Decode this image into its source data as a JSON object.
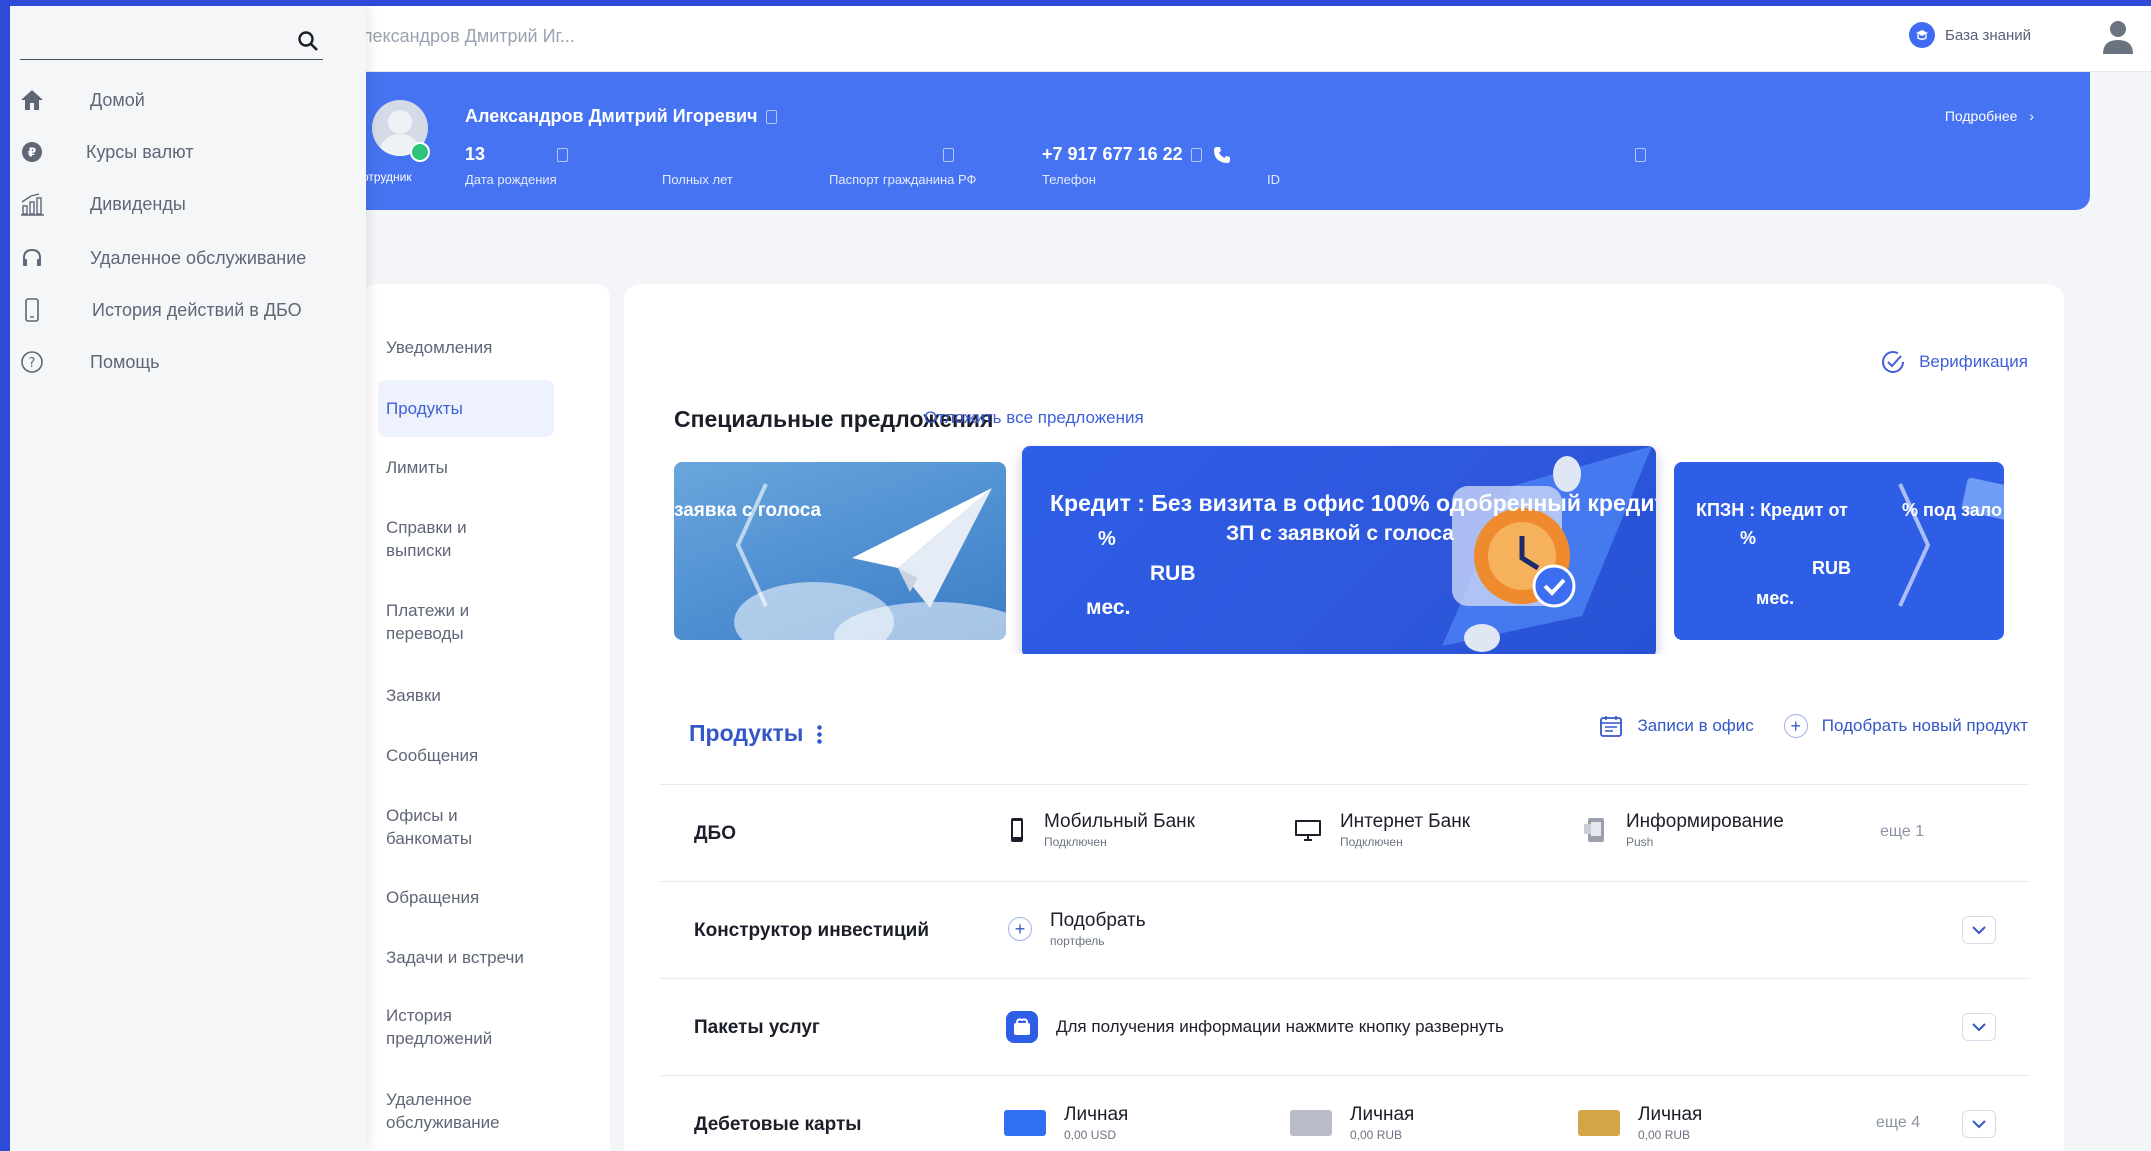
{
  "topbar": {
    "search_value": "лександров Дмитрий Иг...",
    "kb_label": "База знаний"
  },
  "client": {
    "name": "Александров Дмитрий Игоревич",
    "role": "отрудник",
    "birth_value": "13",
    "birth_label": "Дата рождения",
    "age_label": "Полных лет",
    "passport_label": "Паспорт гражданина РФ",
    "phone_value": "+7 917 677 16 22",
    "phone_label": "Телефон",
    "id_label": "ID",
    "more": "Подробнее"
  },
  "nav": {
    "items": [
      "Уведомления",
      "Продукты",
      "Лимиты",
      "Справки и выписки",
      "Платежи и переводы",
      "Заявки",
      "Сообщения",
      "Офисы и банкоматы",
      "Обращения",
      "Задачи и встречи",
      "История предложений",
      "Удаленное обслуживание"
    ],
    "active": "Продукты"
  },
  "main": {
    "verification": "Верификация",
    "offers_title": "Специальные предложения",
    "postpone_all": "Отложить все предложения",
    "offers": {
      "left_text": "заявка с голоса",
      "center_line1": "Кредит : Без визита в офис 100% одобренный кредит",
      "center_line2": "ЗП с заявкой с голоса",
      "center_pct": "%",
      "center_cur": "RUB",
      "center_term": "мес.",
      "right_line1": "КПЗН : Кредит от",
      "right_line1b": "% под зало",
      "right_pct": "%",
      "right_cur": "RUB",
      "right_term": "мес."
    },
    "products_title": "Продукты",
    "office_records": "Записи в офис",
    "pick_product": "Подобрать новый продукт",
    "rows": {
      "dbo": {
        "title": "ДБО",
        "mobile": "Мобильный Банк",
        "mobile_sub": "Подключен",
        "internet": "Интернет Банк",
        "internet_sub": "Подключен",
        "inform": "Информирование",
        "inform_sub": "Push",
        "more": "еще 1"
      },
      "invest": {
        "title": "Конструктор инвестиций",
        "pick": "Подобрать",
        "pick_sub": "портфель"
      },
      "packages": {
        "title": "Пакеты услуг",
        "info": "Для получения информации нажмите кнопку развернуть"
      },
      "cards": {
        "title": "Дебетовые карты",
        "c1": "Личная",
        "c1_sub": "0,00 USD",
        "c2": "Личная",
        "c2_sub": "0,00 RUB",
        "c3": "Личная",
        "c3_sub": "0,00 RUB",
        "more": "еще 4"
      }
    }
  },
  "side_menu": {
    "items": [
      {
        "label": "Домой",
        "icon": "home-icon"
      },
      {
        "label": "Курсы валют",
        "icon": "currency-icon"
      },
      {
        "label": "Дивиденды",
        "icon": "chart-icon"
      },
      {
        "label": "Удаленное обслуживание",
        "icon": "headset-icon"
      },
      {
        "label": "История действий в ДБО",
        "icon": "phone-icon"
      },
      {
        "label": "Помощь",
        "icon": "help-icon"
      }
    ]
  },
  "colors": {
    "accent": "#4673f1",
    "link": "#3f5fd8",
    "frame": "#2d4bd6"
  }
}
